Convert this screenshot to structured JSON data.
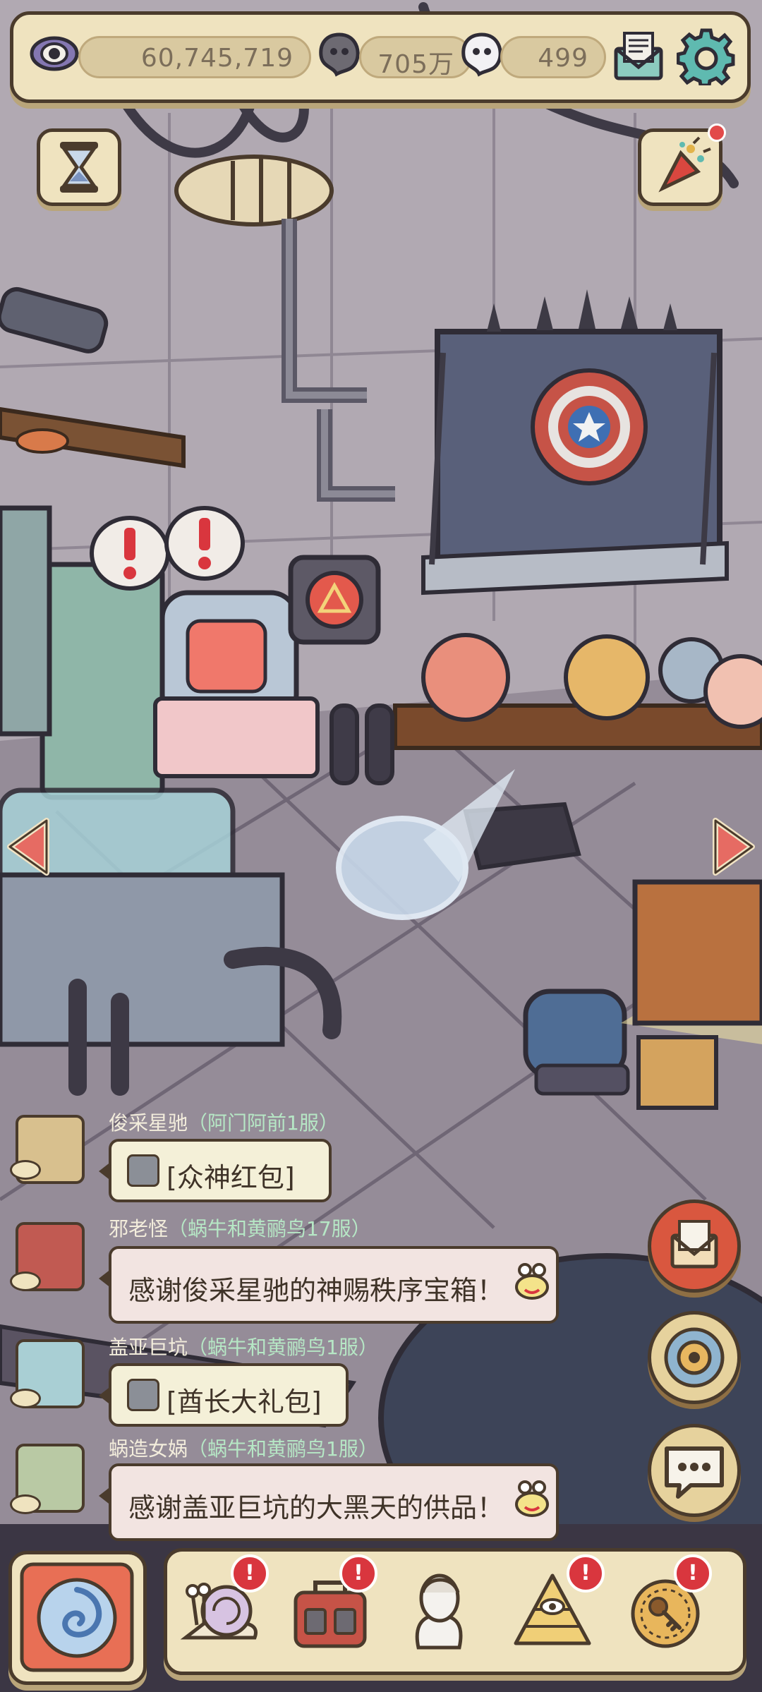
{
  "resources": {
    "eye_value": "60,745,719",
    "soul_value": "705万",
    "ghost_value": "499"
  },
  "chat": [
    {
      "name": "俊采星驰",
      "server": "（阿门阿前1服）",
      "message": "[众神红包]",
      "type": "gift"
    },
    {
      "name": "邪老怪",
      "server": "（蜗牛和黄鹂鸟17服）",
      "message": "感谢俊采星驰的神赐秩序宝箱！",
      "type": "text"
    },
    {
      "name": "盖亚巨坑",
      "server": "（蜗牛和黄鹂鸟1服）",
      "message": "[酋长大礼包]",
      "type": "gift"
    },
    {
      "name": "蜗造女娲",
      "server": "（蜗牛和黄鹂鸟1服）",
      "message": "感谢盖亚巨坑的大黑天的供品！",
      "type": "text"
    }
  ],
  "alerts": {
    "symbol": "!"
  },
  "icons": [
    "eye-icon",
    "soul-icon",
    "ghost-icon",
    "mail-icon",
    "gear-icon",
    "hourglass-icon",
    "party-popper-icon",
    "left-arrow-icon",
    "right-arrow-icon",
    "mail-round-icon",
    "portal-icon",
    "chat-icon",
    "snail-icon",
    "backpack-icon",
    "statue-icon",
    "pyramid-icon",
    "key-coin-icon",
    "vortex-icon"
  ],
  "colors": {
    "panel": "#efe3bf",
    "outline": "#4a3b2c",
    "alert": "#d9363e",
    "server_text": "#b6e7c5"
  }
}
